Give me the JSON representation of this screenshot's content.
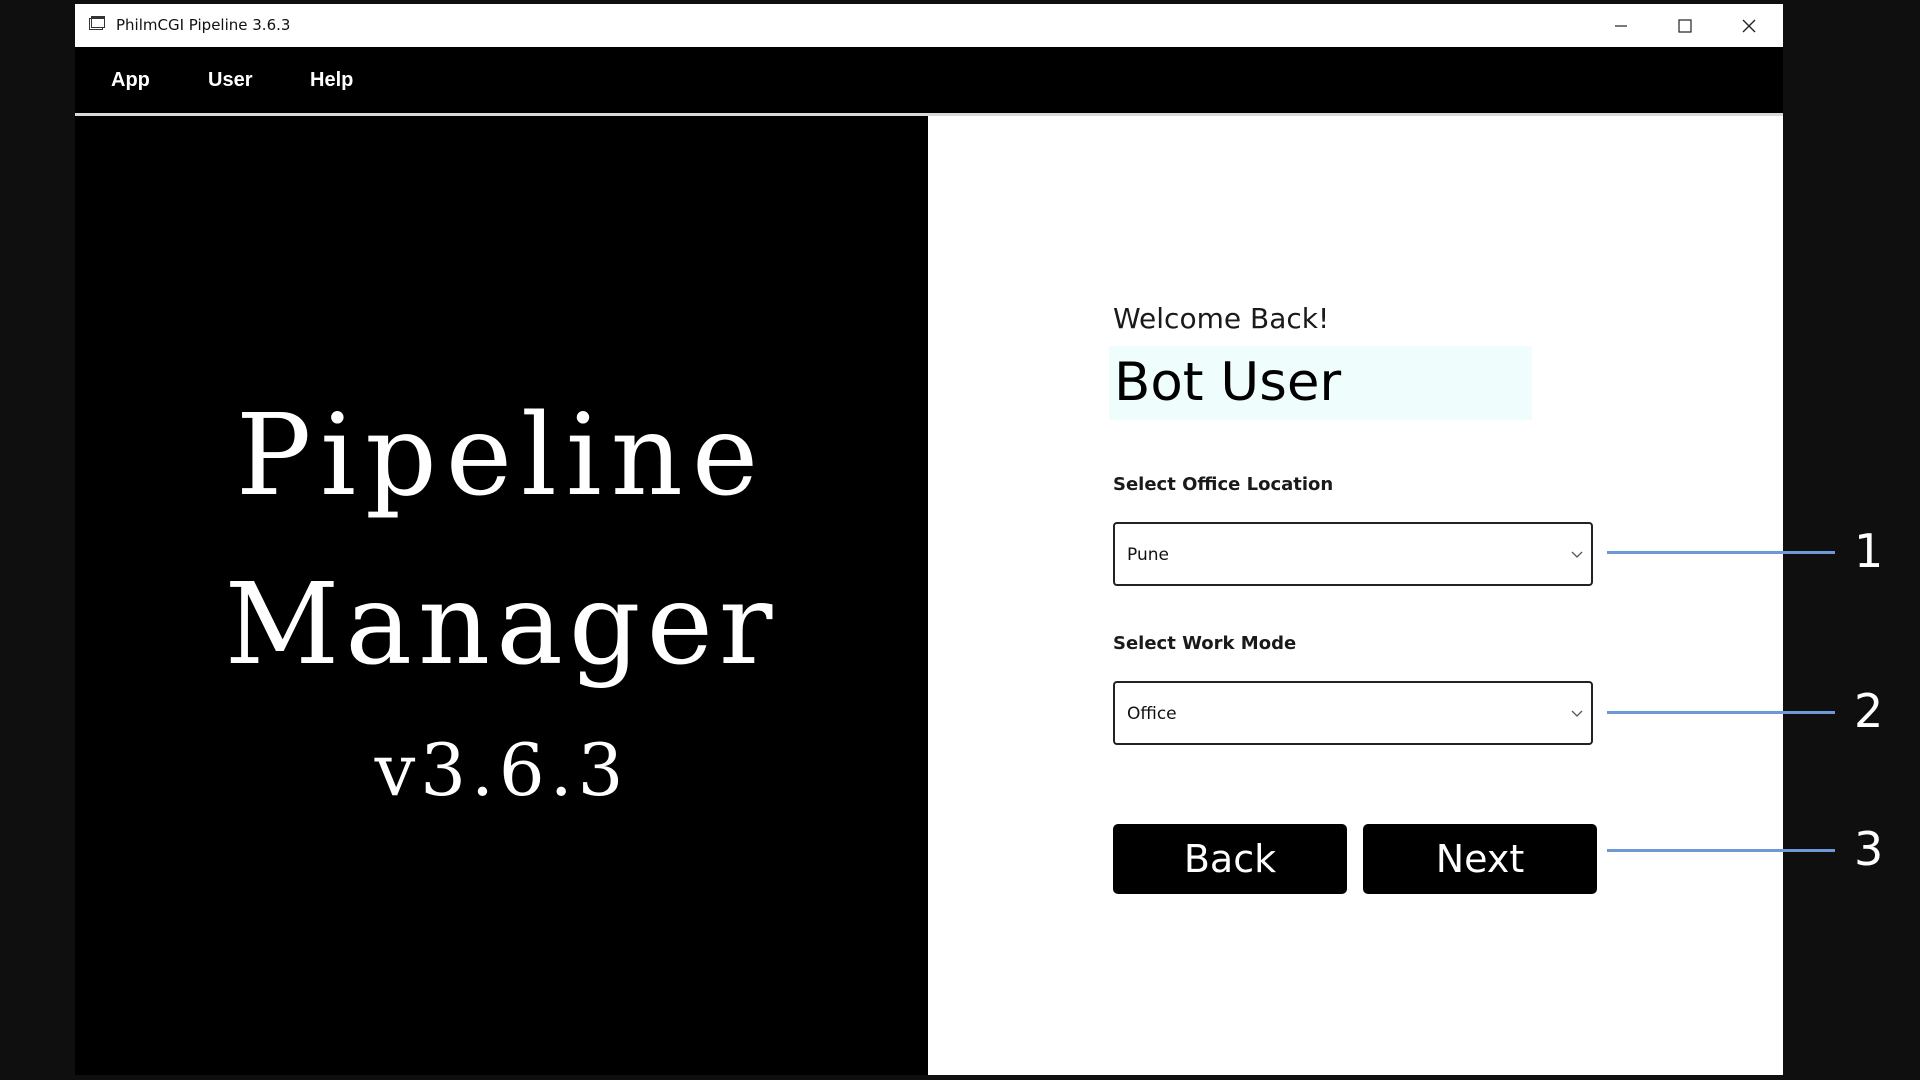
{
  "window": {
    "title": "PhilmCGI Pipeline 3.6.3",
    "controls": {
      "minimize": "minimize-icon",
      "maximize": "maximize-icon",
      "close": "close-icon"
    }
  },
  "menu": {
    "items": [
      "App",
      "User",
      "Help"
    ]
  },
  "brand": {
    "line1": "Pipeline",
    "line2": "Manager",
    "version": "v3.6.3"
  },
  "form": {
    "welcome": "Welcome Back!",
    "user_name": "Bot User",
    "office_location": {
      "label": "Select Office Location",
      "value": "Pune"
    },
    "work_mode": {
      "label": "Select Work Mode",
      "value": "Office"
    },
    "back_label": "Back",
    "next_label": "Next"
  },
  "callouts": [
    "1",
    "2",
    "3"
  ],
  "colors": {
    "callout_line": "#6f98d8",
    "user_box": "#effefd",
    "menubar": "#000000"
  }
}
